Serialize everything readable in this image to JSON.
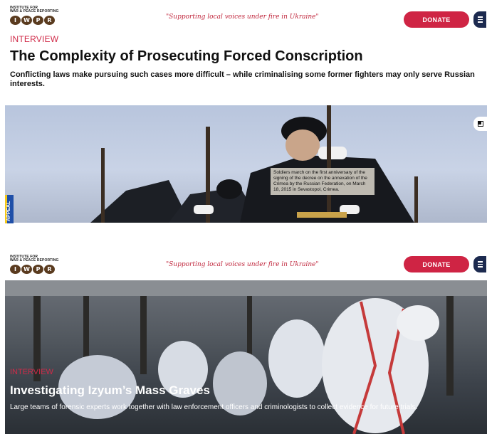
{
  "header": {
    "logo_lines": [
      "INSTITUTE FOR",
      "WAR & PEACE REPORTING"
    ],
    "logo_letters": [
      "I",
      "W",
      "P",
      "R"
    ],
    "tagline": "\"Supporting local voices under fire in Ukraine\"",
    "donate_label": "DONATE",
    "menu_icon": "hamburger-icon"
  },
  "article": {
    "kicker": "INTERVIEW",
    "title": "The Complexity of Prosecuting Forced Conscription",
    "subtitle": "Conflicting laws make pursuing such cases more difficult – while criminalising some former fighters may only serve Russian interests.",
    "image_caption": "Soldiers march on the first anniversary of the signing of the decree on the annexation of the Crimea by the Russian Federation, on March 18, 2015 in Sevastopol, Crimea.",
    "appeal_label": "APPEAL",
    "expand_icon": "expand-icon"
  },
  "feature": {
    "kicker": "INTERVIEW",
    "title": "Investigating Izyum’s Mass Graves",
    "description": "Large teams of forensic experts work together with law enforcement officers and criminologists to collect evidence for future trials."
  },
  "colors": {
    "accent": "#cf2444",
    "menu_bg": "#1c2a4f",
    "logo_brown": "#5a3b1f"
  }
}
